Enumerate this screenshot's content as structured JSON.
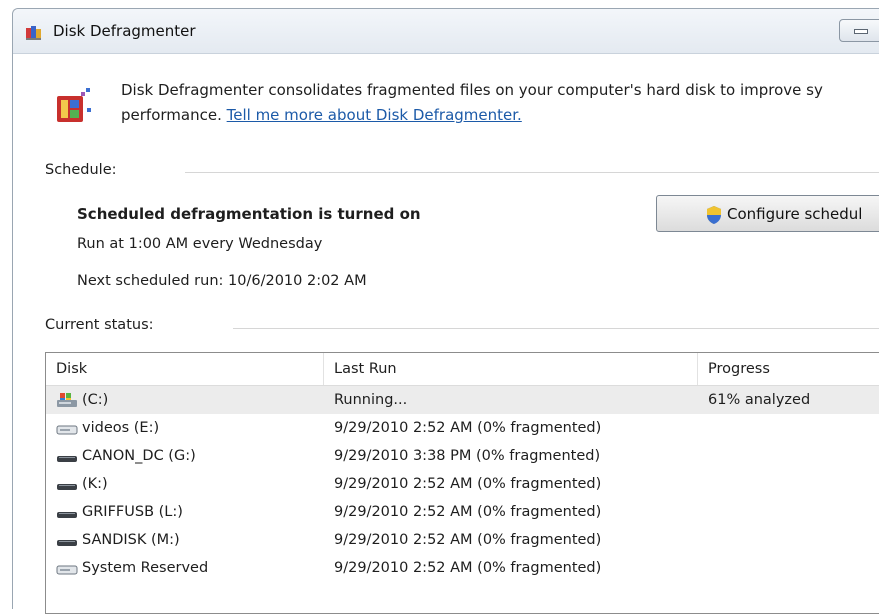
{
  "window": {
    "title": "Disk Defragmenter"
  },
  "intro": {
    "text": "Disk Defragmenter consolidates fragmented files on your computer's hard disk to improve sy",
    "text2": "performance.",
    "link": "Tell me more about Disk Defragmenter."
  },
  "schedule": {
    "label": "Schedule:",
    "heading": "Scheduled defragmentation is turned on",
    "run_at": "Run at 1:00 AM every Wednesday",
    "next_run": "Next scheduled run: 10/6/2010 2:02 AM",
    "configure_button": "Configure schedul"
  },
  "status": {
    "label": "Current status:",
    "columns": [
      "Disk",
      "Last Run",
      "Progress"
    ],
    "rows": [
      {
        "disk": "(C:)",
        "last_run": "Running...",
        "progress": "61% analyzed",
        "icon": "system-drive-icon"
      },
      {
        "disk": "videos (E:)",
        "last_run": "9/29/2010 2:52 AM (0% fragmented)",
        "progress": "",
        "icon": "hard-drive-icon"
      },
      {
        "disk": "CANON_DC (G:)",
        "last_run": "9/29/2010 3:38 PM (0% fragmented)",
        "progress": "",
        "icon": "removable-drive-icon"
      },
      {
        "disk": "(K:)",
        "last_run": "9/29/2010 2:52 AM (0% fragmented)",
        "progress": "",
        "icon": "removable-drive-icon"
      },
      {
        "disk": "GRIFFUSB (L:)",
        "last_run": "9/29/2010 2:52 AM (0% fragmented)",
        "progress": "",
        "icon": "removable-drive-icon"
      },
      {
        "disk": "SANDISK (M:)",
        "last_run": "9/29/2010 2:52 AM (0% fragmented)",
        "progress": "",
        "icon": "removable-drive-icon"
      },
      {
        "disk": "System Reserved",
        "last_run": "9/29/2010 2:52 AM (0% fragmented)",
        "progress": "",
        "icon": "hard-drive-icon"
      }
    ]
  },
  "colors": {
    "link": "#1c5aa8",
    "selected_row": "#ececec"
  }
}
